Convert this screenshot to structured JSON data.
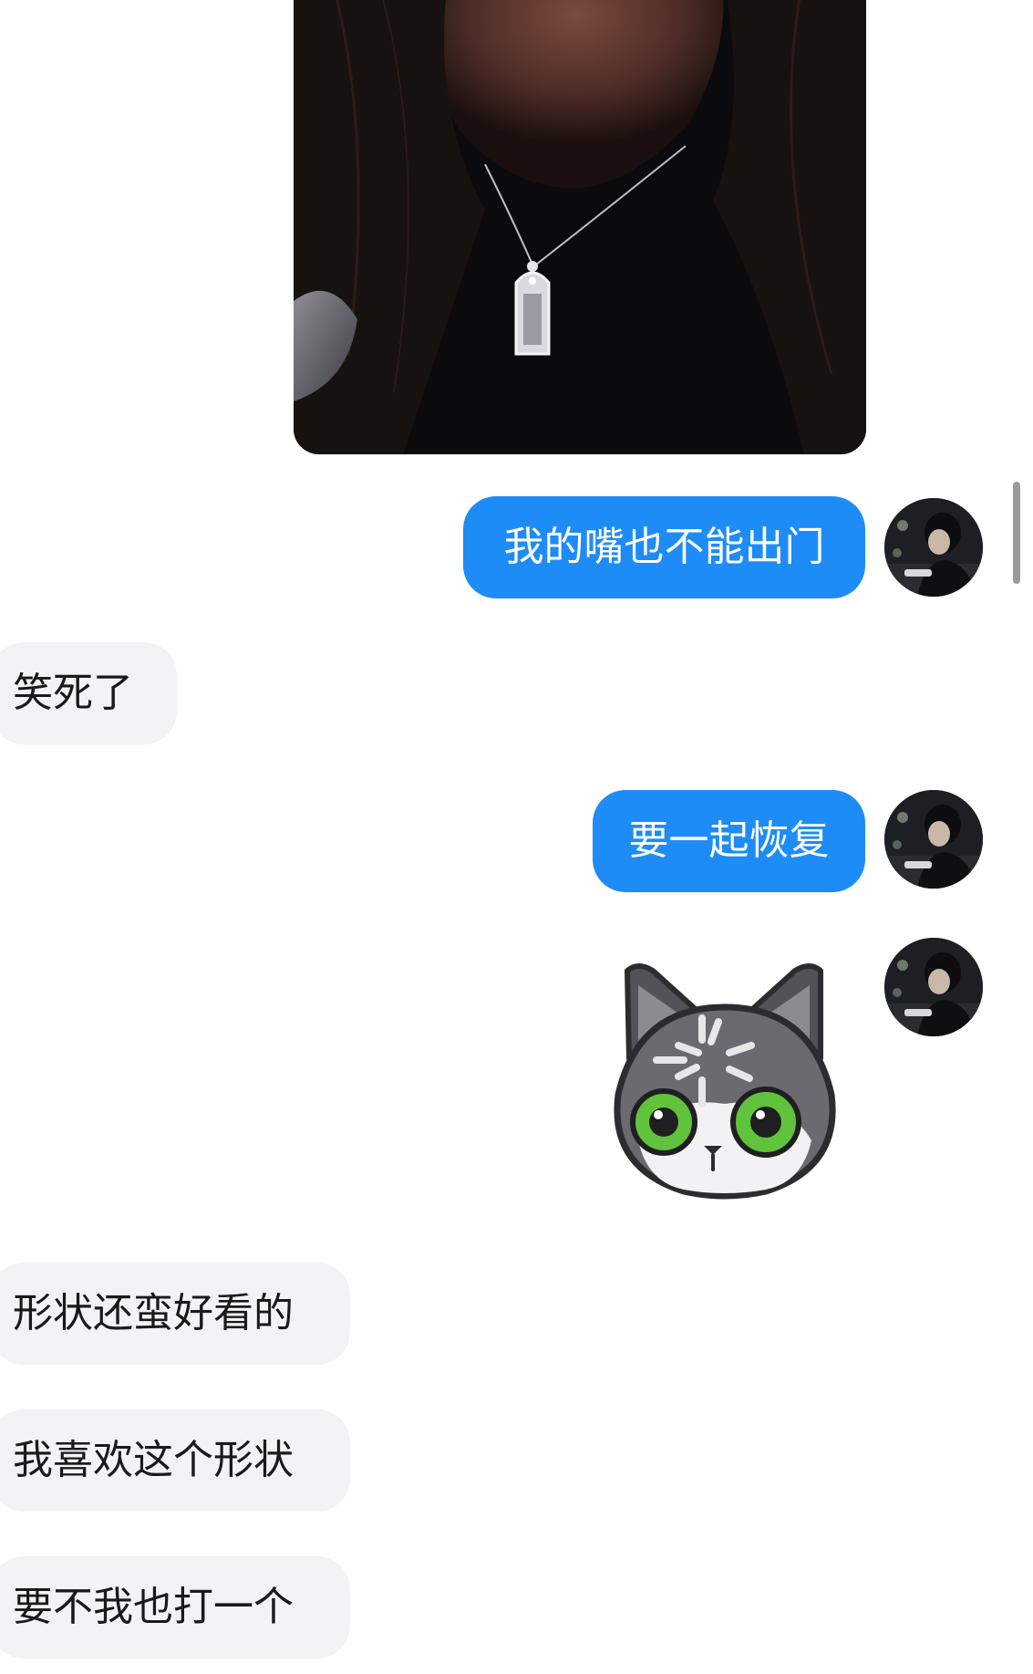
{
  "messages": {
    "out1": "我的嘴也不能出门",
    "in1": "笑死了",
    "out2": "要一起恢复",
    "in2": "形状还蛮好看的",
    "in3": "我喜欢这个形状",
    "in4": "要不我也打一个"
  },
  "colors": {
    "outgoing_bubble": "#1e8cf7",
    "incoming_bubble": "#f3f3f5",
    "outgoing_text": "#ffffff",
    "incoming_text": "#1a1a1a"
  },
  "icons": {
    "sticker": "cat-loading-sticker",
    "avatar": "user-avatar"
  }
}
